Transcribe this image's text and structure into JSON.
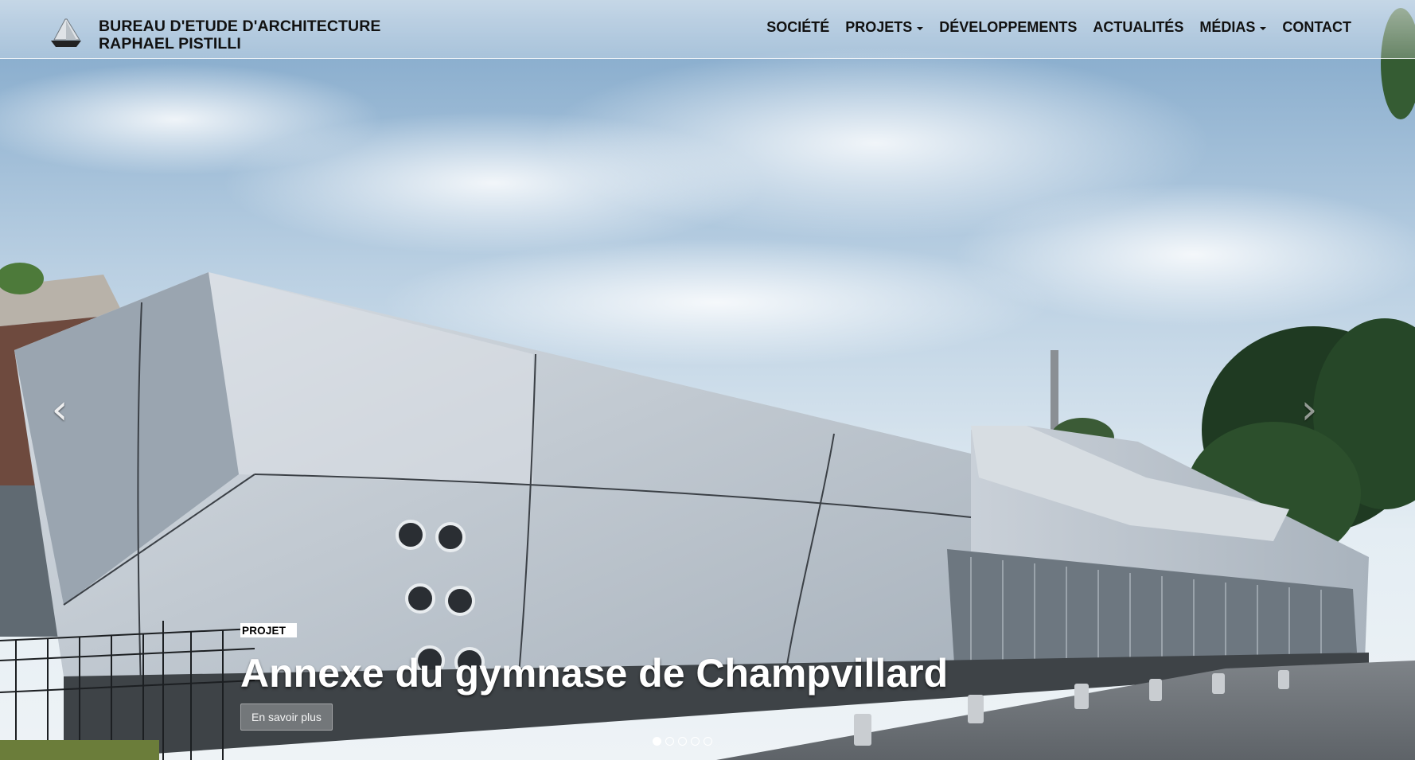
{
  "brand": {
    "line1": "BUREAU D'ETUDE D'ARCHITECTURE",
    "line2": "RAPHAEL PISTILLI",
    "logo_icon": "sailboat-logo"
  },
  "nav": {
    "items": [
      {
        "label": "SOCIÉTÉ",
        "dropdown": false
      },
      {
        "label": "PROJETS",
        "dropdown": true
      },
      {
        "label": "DÉVELOPPEMENTS",
        "dropdown": false
      },
      {
        "label": "ACTUALITÉS",
        "dropdown": false
      },
      {
        "label": "MÉDIAS",
        "dropdown": true
      },
      {
        "label": "CONTACT",
        "dropdown": false
      }
    ]
  },
  "carousel": {
    "prev_icon": "chevron-left-icon",
    "next_icon": "chevron-right-icon",
    "prev_glyph": "‹",
    "next_glyph": "›",
    "badge": "PROJET",
    "title": "Annexe du gymnase de Champvillard",
    "button_label": "En savoir plus",
    "slide_count": 5,
    "active_index": 0
  },
  "colors": {
    "sky": "#c9dcea",
    "building": "#b9c3cc",
    "text_dark": "#111111",
    "white": "#ffffff"
  }
}
